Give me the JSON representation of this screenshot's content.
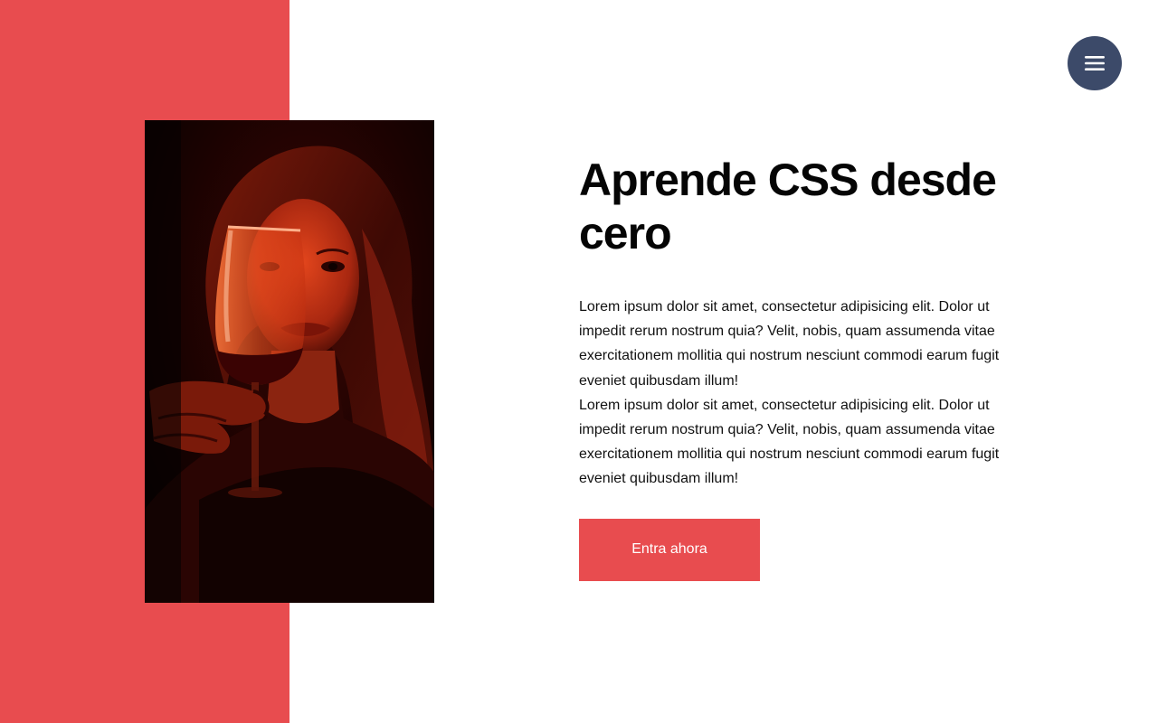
{
  "menu": {
    "icon": "hamburger-menu-icon",
    "color": "#3c4a69"
  },
  "theme": {
    "accent": "#e84c4f",
    "background": "#ffffff",
    "text": "#050505"
  },
  "hero": {
    "image_icon": "woman-with-wine-glass-photo",
    "title": "Aprende CSS desde cero",
    "paragraphs": [
      "Lorem ipsum dolor sit amet, consectetur adipisicing elit. Dolor ut impedit rerum nostrum quia? Velit, nobis, quam assumenda vitae exercitationem mollitia qui nostrum nesciunt commodi earum fugit eveniet quibusdam illum!",
      "Lorem ipsum dolor sit amet, consectetur adipisicing elit. Dolor ut impedit rerum nostrum quia? Velit, nobis, quam assumenda vitae exercitationem mollitia qui nostrum nesciunt commodi earum fugit eveniet quibusdam illum!"
    ],
    "cta_label": "Entra ahora"
  }
}
